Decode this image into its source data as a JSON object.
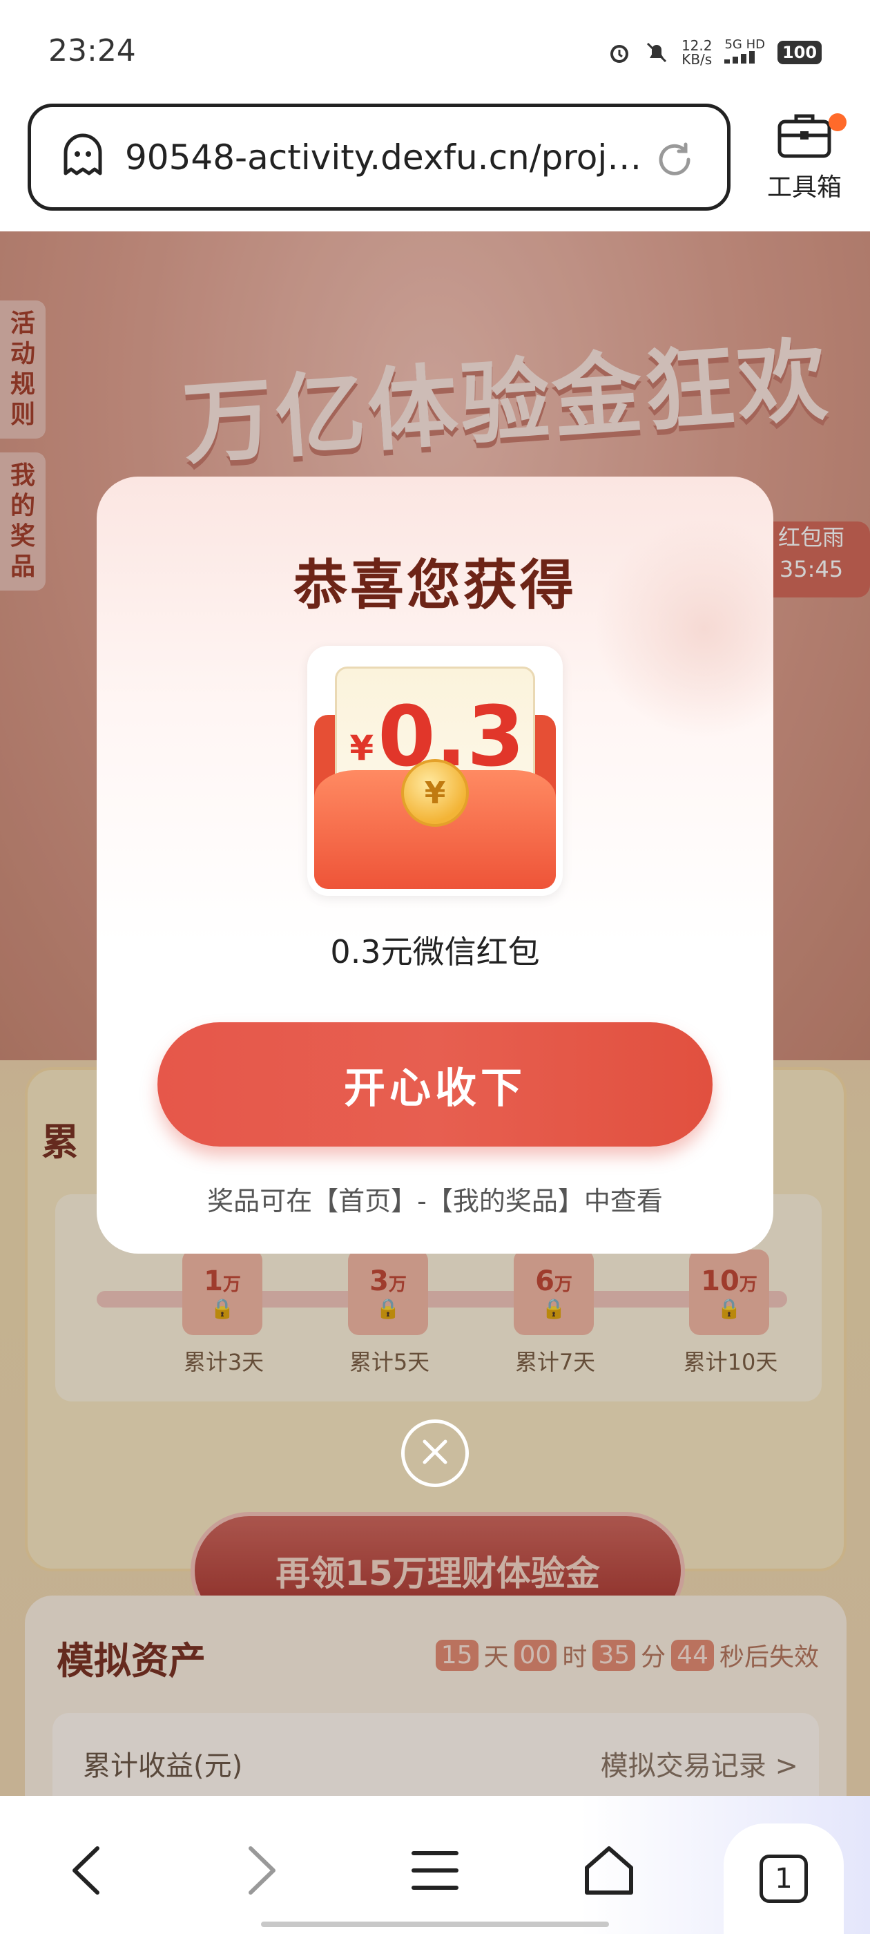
{
  "status_bar": {
    "time": "23:24",
    "speed_value": "12.2",
    "speed_unit": "KB/s",
    "network": "5G HD",
    "battery": "100"
  },
  "browser": {
    "url": "90548-activity.dexfu.cn/proj…",
    "toolbox_label": "工具箱"
  },
  "background": {
    "hero_title": "万亿体验金狂欢节",
    "side_tabs": [
      "活动规则",
      "我的奖品"
    ],
    "rain_badge": {
      "label": "红包雨",
      "time": "35:45"
    },
    "cumulative_title_partial": "累",
    "milestones": [
      {
        "amount": "1",
        "unit": "万",
        "day": "累计3天"
      },
      {
        "amount": "3",
        "unit": "万",
        "day": "累计5天"
      },
      {
        "amount": "6",
        "unit": "万",
        "day": "累计7天"
      },
      {
        "amount": "10",
        "unit": "万",
        "day": "累计10天"
      }
    ],
    "claim_more_button": "再领15万理财体验金",
    "assets": {
      "title": "模拟资产",
      "countdown": {
        "days": "15",
        "days_unit": "天",
        "hours": "00",
        "hours_unit": "时",
        "minutes": "35",
        "minutes_unit": "分",
        "seconds": "44",
        "suffix": "秒后失效"
      },
      "earnings_label": "累计收益(元)",
      "records_link": "模拟交易记录 >"
    }
  },
  "modal": {
    "title": "恭喜您获得",
    "currency_symbol": "¥",
    "amount": "0.3",
    "coin_symbol": "¥",
    "prize_name": "0.3元微信红包",
    "accept_button": "开心收下",
    "hint": "奖品可在【首页】-【我的奖品】中查看"
  },
  "bottom_nav": {
    "tab_count": "1"
  }
}
